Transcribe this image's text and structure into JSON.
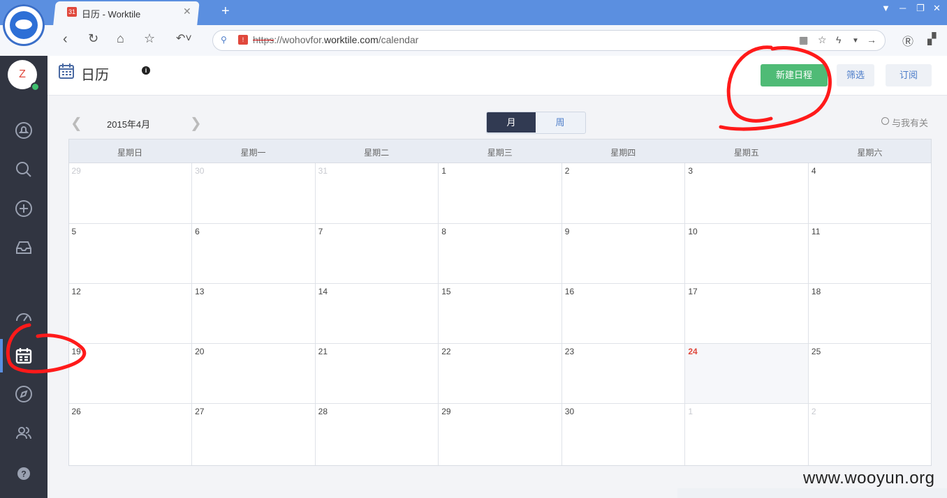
{
  "browser": {
    "tab_title": "日历 - Worktile",
    "tab_favicon": "31",
    "new_tab": "+",
    "address": {
      "protocol": "https",
      "rest_prefix": "://wohovfor.",
      "domain": "worktile.com",
      "path": "/calendar"
    },
    "address_icon": "!"
  },
  "app": {
    "avatar_initial": "Z",
    "page_title": "日历",
    "info_icon": "i",
    "buttons": {
      "new_event": "新建日程",
      "filter": "筛选",
      "subscribe": "订阅"
    }
  },
  "calendar": {
    "month_label": "2015年4月",
    "view_month": "月",
    "view_week": "周",
    "related_label": "与我有关",
    "weekdays": [
      "星期日",
      "星期一",
      "星期二",
      "星期三",
      "星期四",
      "星期五",
      "星期六"
    ],
    "weeks": [
      [
        {
          "d": "29",
          "other": true
        },
        {
          "d": "30",
          "other": true
        },
        {
          "d": "31",
          "other": true
        },
        {
          "d": "1"
        },
        {
          "d": "2"
        },
        {
          "d": "3"
        },
        {
          "d": "4"
        }
      ],
      [
        {
          "d": "5"
        },
        {
          "d": "6"
        },
        {
          "d": "7"
        },
        {
          "d": "8"
        },
        {
          "d": "9"
        },
        {
          "d": "10"
        },
        {
          "d": "11"
        }
      ],
      [
        {
          "d": "12"
        },
        {
          "d": "13"
        },
        {
          "d": "14"
        },
        {
          "d": "15"
        },
        {
          "d": "16"
        },
        {
          "d": "17"
        },
        {
          "d": "18"
        }
      ],
      [
        {
          "d": "19"
        },
        {
          "d": "20"
        },
        {
          "d": "21"
        },
        {
          "d": "22"
        },
        {
          "d": "23"
        },
        {
          "d": "24",
          "today": true
        },
        {
          "d": "25"
        }
      ],
      [
        {
          "d": "26"
        },
        {
          "d": "27"
        },
        {
          "d": "28"
        },
        {
          "d": "29"
        },
        {
          "d": "30"
        },
        {
          "d": "1",
          "other": true
        },
        {
          "d": "2",
          "other": true
        }
      ]
    ]
  },
  "colors": {
    "accent_green": "#4fbb76",
    "sidebar": "#313541",
    "today_red": "#e0483c",
    "annotation_red": "#ff1a1a"
  },
  "watermark": "www.wooyun.org"
}
